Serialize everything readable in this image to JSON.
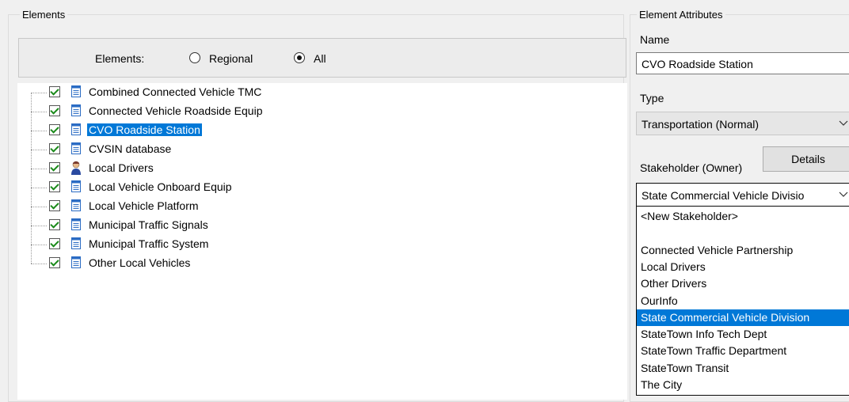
{
  "elements_panel": {
    "title": "Elements",
    "filter": {
      "label": "Elements:",
      "options": [
        {
          "label": "Regional",
          "checked": false
        },
        {
          "label": "All",
          "checked": true
        }
      ]
    },
    "tree_items": [
      {
        "label": "Combined Connected Vehicle TMC",
        "checked": true,
        "icon": "document-icon",
        "selected": false
      },
      {
        "label": "Connected Vehicle Roadside Equip",
        "checked": true,
        "icon": "document-icon",
        "selected": false
      },
      {
        "label": "CVO Roadside Station",
        "checked": true,
        "icon": "document-icon",
        "selected": true
      },
      {
        "label": "CVSIN database",
        "checked": true,
        "icon": "document-icon",
        "selected": false
      },
      {
        "label": "Local Drivers",
        "checked": true,
        "icon": "person-icon",
        "selected": false
      },
      {
        "label": "Local Vehicle Onboard Equip",
        "checked": true,
        "icon": "document-icon",
        "selected": false
      },
      {
        "label": "Local Vehicle Platform",
        "checked": true,
        "icon": "document-icon",
        "selected": false
      },
      {
        "label": "Municipal Traffic Signals",
        "checked": true,
        "icon": "document-icon",
        "selected": false
      },
      {
        "label": "Municipal Traffic System",
        "checked": true,
        "icon": "document-icon",
        "selected": false
      },
      {
        "label": "Other Local Vehicles",
        "checked": true,
        "icon": "document-icon",
        "selected": false
      }
    ]
  },
  "attributes_panel": {
    "title": "Element Attributes",
    "name_label": "Name",
    "name_value": "CVO Roadside Station",
    "type_label": "Type",
    "type_value": "Transportation (Normal)",
    "stakeholder_label": "Stakeholder (Owner)",
    "details_button": "Details",
    "stakeholder_value": "State Commercial Vehicle Divisio",
    "stakeholder_options": [
      {
        "label": "<New Stakeholder>",
        "selected": false
      },
      {
        "label": "",
        "selected": false
      },
      {
        "label": "Connected Vehicle Partnership",
        "selected": false
      },
      {
        "label": "Local Drivers",
        "selected": false
      },
      {
        "label": "Other Drivers",
        "selected": false
      },
      {
        "label": "OurInfo",
        "selected": false
      },
      {
        "label": "State Commercial Vehicle Division",
        "selected": true
      },
      {
        "label": "StateTown Info Tech Dept",
        "selected": false
      },
      {
        "label": "StateTown Traffic Department",
        "selected": false
      },
      {
        "label": "StateTown Transit",
        "selected": false
      },
      {
        "label": "The City",
        "selected": false
      }
    ]
  },
  "colors": {
    "selection": "#0078d7",
    "check": "#1a8a1a",
    "window_bg": "#f0f0f0"
  }
}
